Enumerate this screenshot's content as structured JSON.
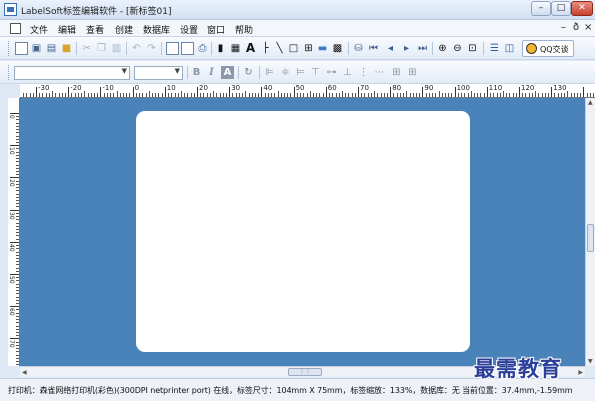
{
  "window": {
    "title": "LabelSoft标签编辑软件 - [新标签01]",
    "controls": {
      "minimize": "–",
      "maximize": "□",
      "close": "✕"
    }
  },
  "menu": {
    "items": [
      "文件",
      "编辑",
      "查看",
      "创建",
      "数据库",
      "设置",
      "窗口",
      "帮助"
    ],
    "mdi_controls": [
      "–",
      "ð",
      "×"
    ]
  },
  "toolbar1": {
    "icons": [
      "new-icon",
      "open-icon",
      "save-icon",
      "folder-icon",
      "cut-icon",
      "copy-icon",
      "paste-icon",
      "undo-icon",
      "redo-icon",
      "page-setup-icon",
      "print-preview-icon",
      "print-icon",
      "barcode-icon",
      "qrcode-icon",
      "text-icon",
      "line-h-icon",
      "line-diag-icon",
      "rectangle-icon",
      "table-icon",
      "image-icon",
      "pdf417-icon",
      "database-icon",
      "first-record-icon",
      "prev-record-icon",
      "next-record-icon",
      "last-record-icon",
      "zoom-in-icon",
      "zoom-out-icon",
      "zoom-fit-icon",
      "split-h-icon",
      "split-v-icon"
    ],
    "qq_label": "QQ交谈"
  },
  "toolbar2": {
    "font_value": "",
    "size_value": "",
    "icons": [
      "bold-icon",
      "italic-icon",
      "text-style-icon",
      "rotate-icon",
      "align-left-icon",
      "align-center-icon",
      "align-right-icon",
      "align-top-icon",
      "align-middle-icon",
      "align-bottom-icon",
      "distribute-h-icon",
      "distribute-v-icon",
      "grid-icon",
      "snap-icon"
    ]
  },
  "ruler": {
    "h_labels": [
      "-30",
      "-20",
      "-10",
      "0",
      "10",
      "20",
      "30",
      "40",
      "50",
      "60",
      "70",
      "80",
      "90",
      "100",
      "110",
      "120",
      "130",
      "140"
    ],
    "v_labels": [
      "0",
      "10",
      "20",
      "30",
      "40",
      "50",
      "60",
      "70"
    ]
  },
  "statusbar": {
    "text": "打印机：森雀网络打印机(彩色)(300DPI netprinter port) 在线，标签尺寸：104mm X 75mm，标签缩放：133%，数据库：无  当前位置：37.4mm,-1.59mm"
  },
  "watermark": "最需教育",
  "colors": {
    "canvas": "#4a83b9",
    "label": "#ffffff",
    "chrome": "#dfe8f5",
    "watermark": "#2b3f9a"
  }
}
